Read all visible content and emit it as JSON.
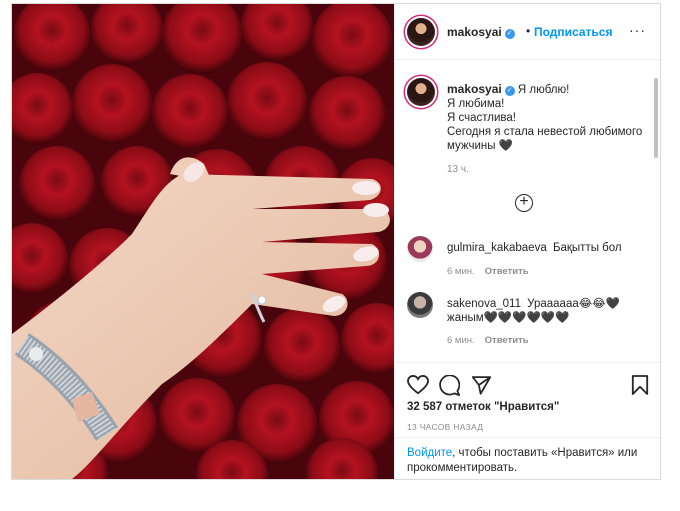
{
  "post": {
    "username": "makosyai",
    "follow_label": "Подписаться",
    "dot": "•",
    "more_label": "···"
  },
  "caption": {
    "username": "makosyai",
    "lines": [
      "Я люблю!",
      "Я любима!",
      "Я счастлива!",
      "Сегодня я стала невестой любимого мужчины 🖤"
    ],
    "time": "13 ч."
  },
  "load_more_icon": "plus-circle-icon",
  "comments": [
    {
      "username": "gulmira_kakabaeva",
      "text": "Бақытты бол",
      "time": "6 мин.",
      "reply_label": "Ответить"
    },
    {
      "username": "sakenova_011",
      "text": "Ураааааа😂😂🖤 жаным🖤🖤🖤🖤🖤🖤",
      "time": "6 мин.",
      "reply_label": "Ответить"
    }
  ],
  "actions": {
    "icons": [
      "heart-icon",
      "comment-icon",
      "share-icon",
      "bookmark-icon"
    ],
    "likes": "32 587 отметок \"Нравится\"",
    "time_ago": "13 ЧАСОВ НАЗАД"
  },
  "login_prompt": {
    "link": "Войдите",
    "rest": ", чтобы поставить «Нравится» или прокомментировать."
  },
  "colors": {
    "accent": "#0095f6",
    "verified": "#3897f0",
    "text": "#262626",
    "muted": "#8e8e8e",
    "border": "#dbdbdb"
  }
}
